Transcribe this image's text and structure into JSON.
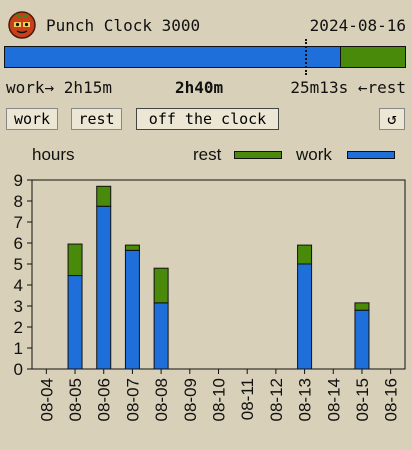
{
  "app": {
    "title": "Punch Clock 3000",
    "date": "2024-08-16",
    "logo_icon": "tomato-face-icon"
  },
  "progress": {
    "work_fraction": 0.84
  },
  "stats": {
    "work": "work→ 2h15m",
    "total": "2h40m",
    "rest": "25m13s ←rest"
  },
  "buttons": {
    "work": "work",
    "rest": "rest",
    "off": "off the clock",
    "reset": "↺"
  },
  "legend": {
    "ylabel": "hours",
    "rest": "rest",
    "work": "work"
  },
  "colors": {
    "work": "#1e6fd9",
    "rest": "#4a8a0a",
    "background": "#d8d0b8"
  },
  "chart_data": {
    "type": "bar",
    "stacked": true,
    "categories": [
      "08-04",
      "08-05",
      "08-06",
      "08-07",
      "08-08",
      "08-09",
      "08-10",
      "08-11",
      "08-12",
      "08-13",
      "08-14",
      "08-15",
      "08-16"
    ],
    "series": [
      {
        "name": "work",
        "values": [
          0,
          4.45,
          7.75,
          5.65,
          3.15,
          0,
          0,
          0,
          0,
          5.0,
          0,
          2.8,
          0
        ]
      },
      {
        "name": "rest",
        "values": [
          0,
          1.5,
          0.95,
          0.25,
          1.65,
          0,
          0,
          0,
          0,
          0.9,
          0,
          0.35,
          0
        ]
      }
    ],
    "ylabel": "hours",
    "yticks": [
      0,
      1,
      2,
      3,
      4,
      5,
      6,
      7,
      8,
      9
    ],
    "ylim": [
      0,
      9
    ],
    "legend_position": "top-right"
  }
}
